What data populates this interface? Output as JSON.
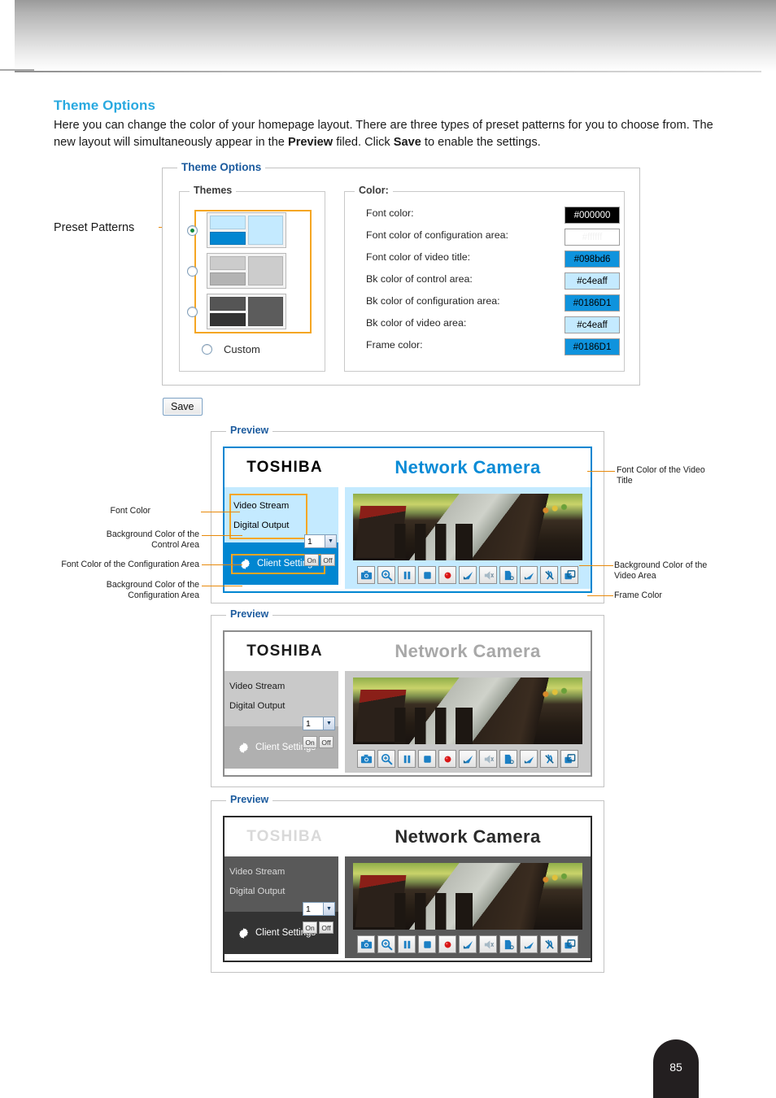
{
  "document": {
    "page_number": "85"
  },
  "section": {
    "title": "Theme Options",
    "body_part1": "Here you can change the color of your homepage layout. There are three types of preset patterns for you to choose from. The new layout will simultaneously appear in the ",
    "body_bold1": "Preview",
    "body_part2": " filed. Click ",
    "body_bold2": "Save",
    "body_part3": " to enable the settings."
  },
  "theme_options": {
    "legend": "Theme Options",
    "themes": {
      "legend": "Themes",
      "custom_label": "Custom",
      "selected_index": 0,
      "presets": [
        {
          "name": "blue-theme",
          "selected": true,
          "control_bg": "#c4eaff",
          "config_bg": "#0186D1",
          "video_bg": "#c4eaff"
        },
        {
          "name": "gray-theme",
          "selected": false,
          "control_bg": "#cccccc",
          "config_bg": "#b3b3b3",
          "video_bg": "#cccccc"
        },
        {
          "name": "dark-theme",
          "selected": false,
          "control_bg": "#555555",
          "config_bg": "#333333",
          "video_bg": "#5c5c5c"
        }
      ]
    },
    "color": {
      "legend": "Color:",
      "rows": [
        {
          "label": "Font color:",
          "value": "#000000",
          "swatch_bg": "#000000",
          "text_color": "#ffffff"
        },
        {
          "label": "Font color of configuration area:",
          "value": "#ffffff",
          "swatch_bg": "#ffffff",
          "text_color": "#f2f2f2"
        },
        {
          "label": "Font color of video title:",
          "value": "#098bd6",
          "swatch_bg": "#0f93dd",
          "text_color": "#000000"
        },
        {
          "label": "Bk color of control area:",
          "value": "#c4eaff",
          "swatch_bg": "#c4eaff",
          "text_color": "#000000"
        },
        {
          "label": "Bk color of configuration area:",
          "value": "#0186D1",
          "swatch_bg": "#0f93dd",
          "text_color": "#000000"
        },
        {
          "label": "Bk color of video area:",
          "value": "#c4eaff",
          "swatch_bg": "#c4eaff",
          "text_color": "#000000"
        },
        {
          "label": "Frame color:",
          "value": "#0186D1",
          "swatch_bg": "#0f93dd",
          "text_color": "#000000"
        }
      ]
    }
  },
  "save_button": {
    "label": "Save"
  },
  "preset_patterns_annotation": "Preset Patterns",
  "previews": [
    {
      "legend": "Preview",
      "brand": "TOSHIBA",
      "video_title": "Network Camera",
      "video_stream_label": "Video Stream",
      "video_stream_value": "1",
      "digital_output_label": "Digital Output",
      "on_label": "On",
      "off_label": "Off",
      "client_settings_label": "Client Settings",
      "colors": {
        "frame": "#0186D1",
        "title_font": "#098bd6",
        "control_bg": "#c4eaff",
        "config_bg": "#0186D1",
        "config_font": "#ffffff",
        "video_bg": "#c4eaff",
        "font": "#000000"
      },
      "highlight_boxes": true
    },
    {
      "legend": "Preview",
      "brand": "TOSHIBA",
      "video_title": "Network Camera",
      "video_stream_label": "Video Stream",
      "video_stream_value": "1",
      "digital_output_label": "Digital Output",
      "on_label": "On",
      "off_label": "Off",
      "client_settings_label": "Client Settings",
      "colors": {
        "frame": "#8c8c8c",
        "title_font": "#a8a8a8",
        "control_bg": "#c9c9c9",
        "config_bg": "#b0b0b0",
        "config_font": "#ffffff",
        "video_bg": "#c9c9c9",
        "font": "#1a1a1a"
      },
      "highlight_boxes": false
    },
    {
      "legend": "Preview",
      "brand": "TOSHIBA",
      "video_title": "Network Camera",
      "video_stream_label": "Video Stream",
      "video_stream_value": "1",
      "digital_output_label": "Digital Output",
      "on_label": "On",
      "off_label": "Off",
      "client_settings_label": "Client Settings",
      "colors": {
        "frame": "#2b2b2b",
        "title_font": "#2b2b2b",
        "control_bg": "#595959",
        "config_bg": "#333333",
        "config_font": "#ffffff",
        "video_bg": "#595959",
        "font": "#d9d9d9"
      },
      "highlight_boxes": false
    }
  ],
  "control_icons": [
    "snapshot-icon",
    "digital-zoom-icon",
    "pause-icon",
    "stop-icon",
    "record-icon",
    "volume-icon",
    "mute-icon",
    "talk-icon",
    "mic-icon",
    "mic-mute-icon",
    "fullscreen-icon"
  ],
  "annotations": {
    "left": [
      {
        "name": "font-color",
        "text": "Font Color"
      },
      {
        "name": "background-color-control-area",
        "text": "Background Color of the\nControl Area"
      },
      {
        "name": "font-color-configuration-area",
        "text": "Font Color of the Configuration Area"
      },
      {
        "name": "background-color-configuration-area",
        "text": "Background Color of the\nConfiguration Area"
      }
    ],
    "right": [
      {
        "name": "font-color-video-title",
        "text": "Font Color of the Video\nTitle"
      },
      {
        "name": "background-color-video-area",
        "text": "Background Color of the\nVideo Area"
      },
      {
        "name": "frame-color",
        "text": "Frame Color"
      }
    ]
  }
}
